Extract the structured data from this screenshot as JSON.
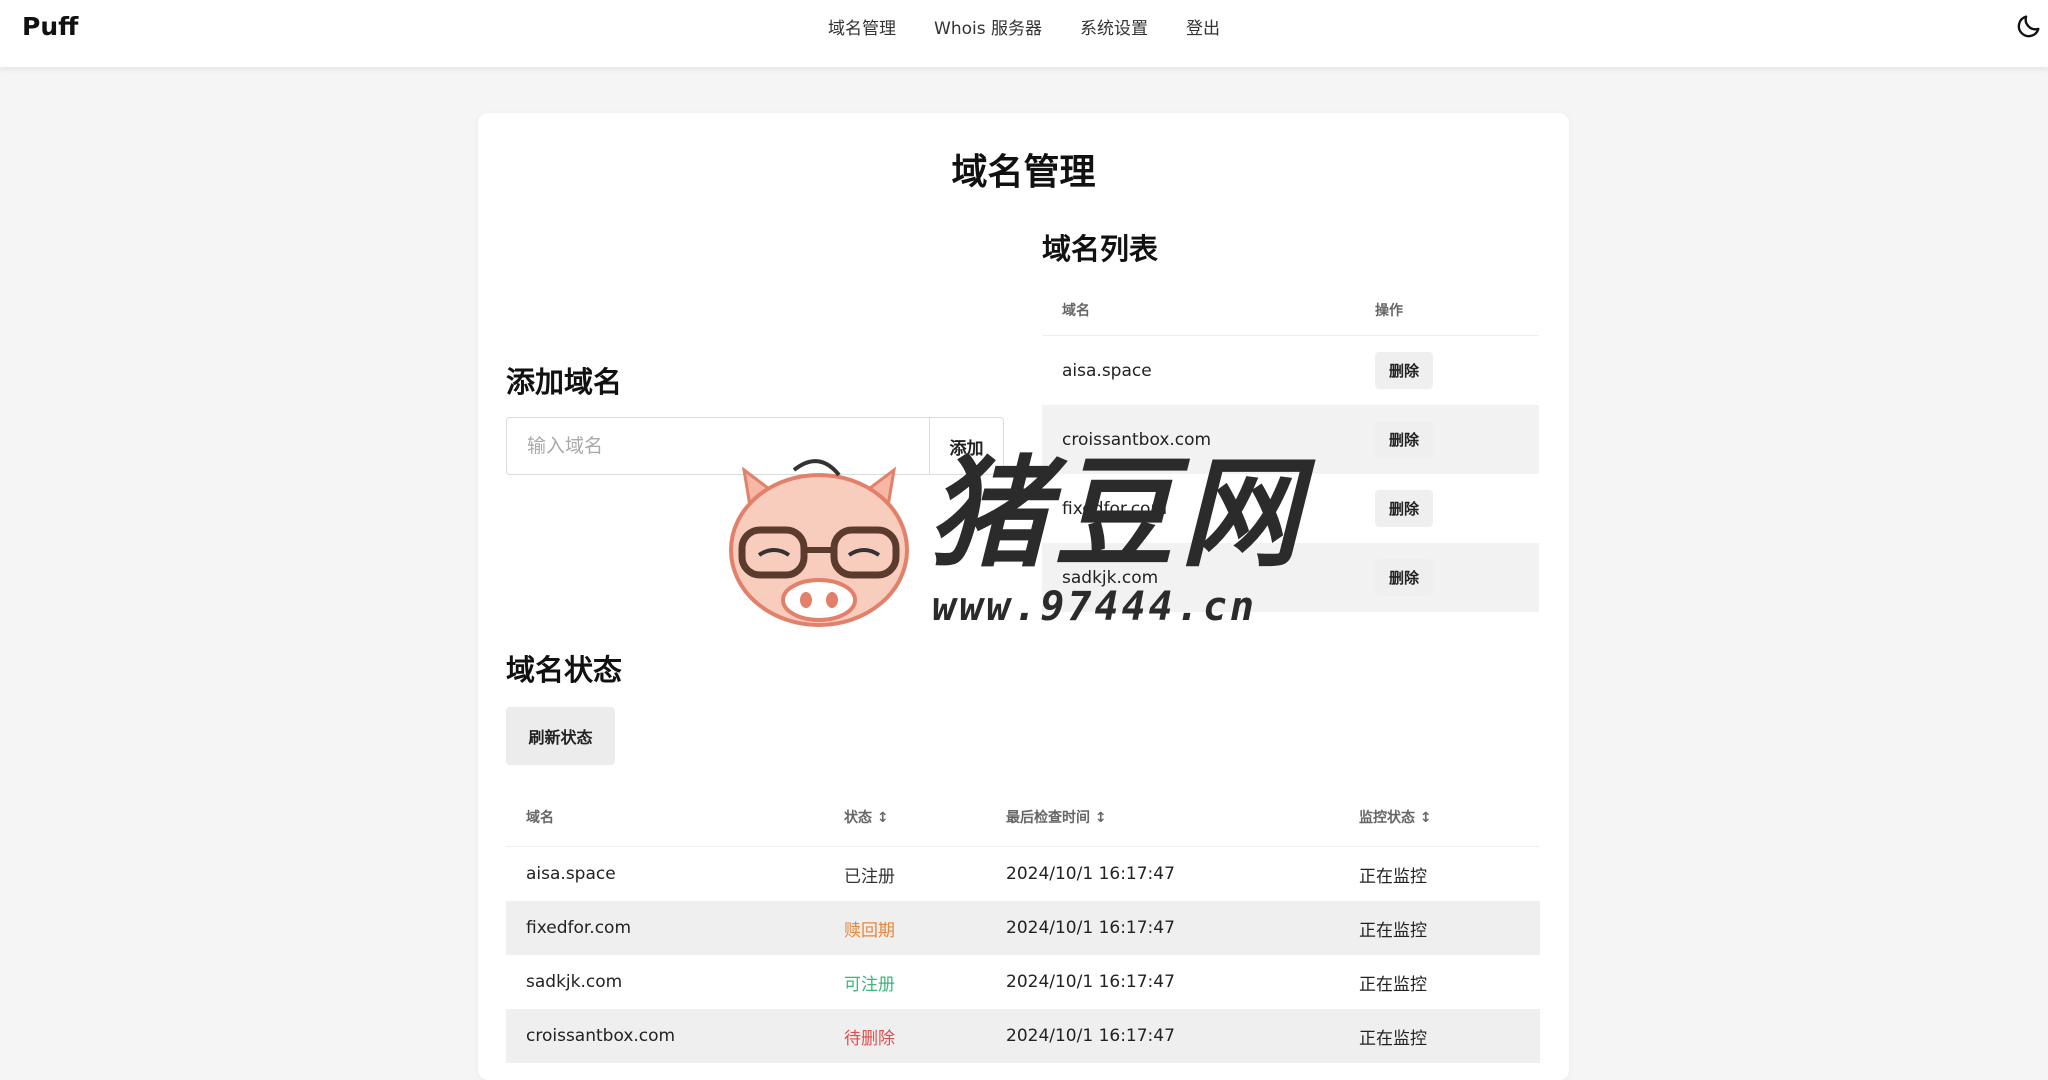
{
  "app": {
    "brand": "Puff"
  },
  "nav": {
    "items": [
      "域名管理",
      "Whois 服务器",
      "系统设置",
      "登出"
    ]
  },
  "icons": {
    "theme_toggle": "moon-icon"
  },
  "page": {
    "title": "域名管理"
  },
  "add_domain": {
    "heading": "添加域名",
    "placeholder": "输入域名",
    "button": "添加"
  },
  "domain_list": {
    "heading": "域名列表",
    "columns": [
      "域名",
      "操作"
    ],
    "delete_label": "删除",
    "rows": [
      "aisa.space",
      "croissantbox.com",
      "fixedfor.com",
      "sadkjk.com"
    ]
  },
  "domain_status": {
    "heading": "域名状态",
    "refresh_button": "刷新状态",
    "columns": [
      "域名",
      "状态 ↕",
      "最后检查时间 ↕",
      "监控状态 ↕"
    ],
    "rows": [
      {
        "domain": "aisa.space",
        "status": "已注册",
        "status_color": "#333333",
        "checked": "2024/10/1 16:17:47",
        "monitor": "正在监控"
      },
      {
        "domain": "fixedfor.com",
        "status": "赎回期",
        "status_color": "#e8853a",
        "checked": "2024/10/1 16:17:47",
        "monitor": "正在监控"
      },
      {
        "domain": "sadkjk.com",
        "status": "可注册",
        "status_color": "#38b87a",
        "checked": "2024/10/1 16:17:47",
        "monitor": "正在监控"
      },
      {
        "domain": "croissantbox.com",
        "status": "待删除",
        "status_color": "#e24c4c",
        "checked": "2024/10/1 16:17:47",
        "monitor": "正在监控"
      }
    ]
  },
  "watermark": {
    "text": "猪豆网",
    "url": "www.97444.cn"
  }
}
